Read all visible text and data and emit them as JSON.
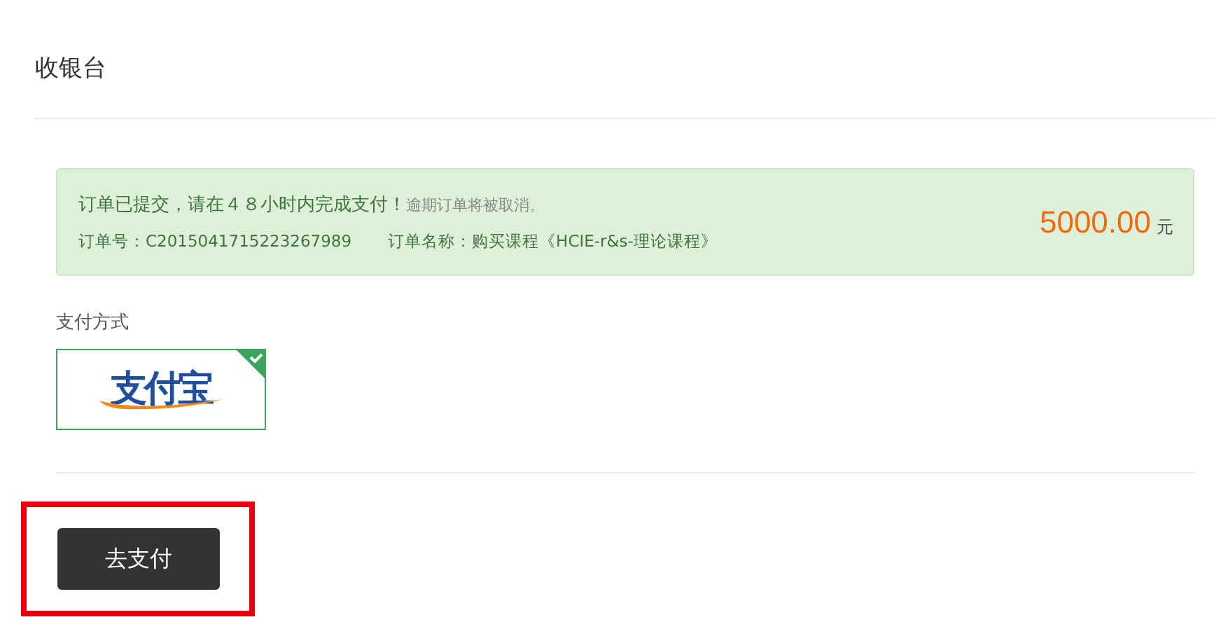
{
  "page_title": "收银台",
  "order": {
    "notice": "订单已提交，请在４８小时内完成支付！",
    "notice_hint": "逾期订单将被取消。",
    "order_number": "订单号：C2015041715223267989",
    "order_name": "订单名称：购买课程《HCIE-r&s-理论课程》",
    "amount": "5000.00",
    "currency": "元"
  },
  "payment": {
    "label": "支付方式",
    "methods": [
      {
        "logo_text": "支付宝",
        "selected": true
      }
    ]
  },
  "pay_button": {
    "label": "去支付",
    "highlighted": true
  }
}
